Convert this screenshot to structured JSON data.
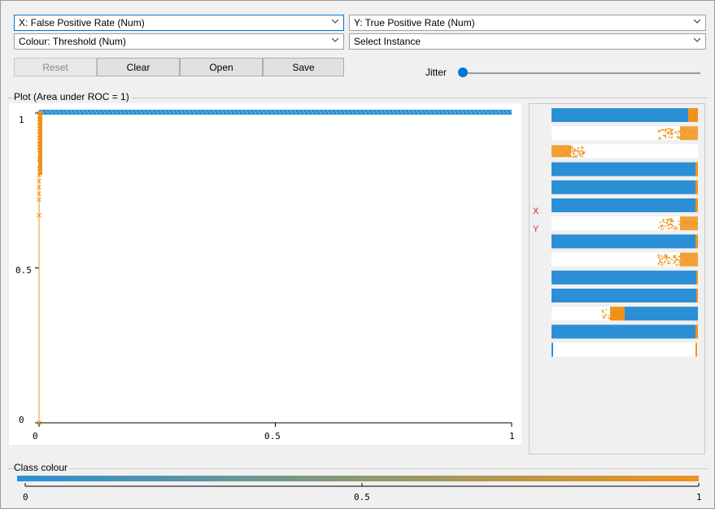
{
  "controls": {
    "x_select": "X: False Positive Rate (Num)",
    "y_select": "Y: True Positive Rate (Num)",
    "colour_select": "Colour: Threshold (Num)",
    "instance_select": "Select Instance",
    "jitter_label": "Jitter",
    "jitter_value": 0
  },
  "buttons": {
    "reset": "Reset",
    "clear": "Clear",
    "open": "Open",
    "save": "Save"
  },
  "plot": {
    "title": "Plot (Area under ROC = 1)",
    "y_ticks": [
      "1",
      "0.5",
      "0"
    ],
    "x_ticks": [
      "0",
      "0.5",
      "1"
    ]
  },
  "attribute_panel": {
    "x_marker": "X",
    "y_marker": "Y",
    "x_row": 5,
    "y_row": 6
  },
  "class_colour": {
    "title": "Class colour",
    "ticks": [
      "0",
      "0.5",
      "1"
    ]
  },
  "colors": {
    "blue": "#2b8fd6",
    "orange": "#f0921a",
    "accent": "#0078d7"
  },
  "chart_data": {
    "type": "scatter",
    "title": "Plot (Area under ROC = 1)",
    "xlabel": "",
    "ylabel": "",
    "xlim": [
      0,
      1
    ],
    "ylim": [
      0,
      1
    ],
    "x_ticks": [
      "0",
      "0.5",
      "1"
    ],
    "y_ticks": [
      "0",
      "0.5",
      "1"
    ],
    "series": [
      {
        "color": "#2b8fd6",
        "x_range": [
          0,
          1
        ],
        "y": 1
      },
      {
        "color": "#f0921a",
        "x": 0,
        "y_values": [
          0,
          0.67,
          0.72,
          0.74,
          0.76,
          0.78,
          0.8,
          0.82,
          0.85,
          0.88,
          0.9,
          0.92,
          0.94,
          0.96,
          0.98,
          1
        ]
      }
    ]
  }
}
